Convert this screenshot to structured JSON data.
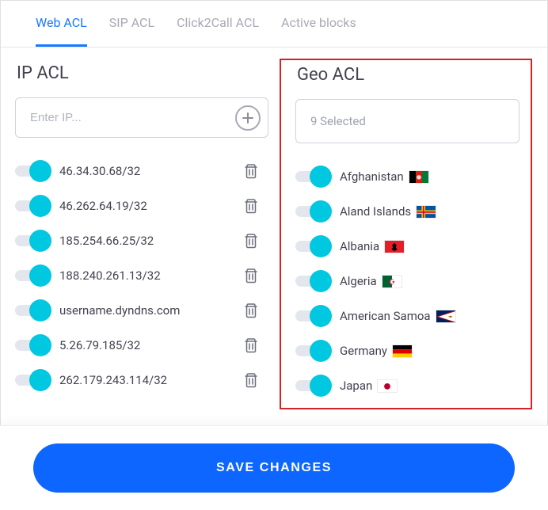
{
  "tabs": [
    {
      "label": "Web ACL",
      "active": true
    },
    {
      "label": "SIP ACL",
      "active": false
    },
    {
      "label": "Click2Call ACL",
      "active": false
    },
    {
      "label": "Active blocks",
      "active": false
    }
  ],
  "ip_acl": {
    "title": "IP ACL",
    "input_placeholder": "Enter IP...",
    "items": [
      "46.34.30.68/32",
      "46.262.64.19/32",
      "185.254.66.25/32",
      "188.240.261.13/32",
      "username.dyndns.com",
      "5.26.79.185/32",
      "262.179.243.114/32"
    ]
  },
  "geo_acl": {
    "title": "Geo ACL",
    "selected_label": "9 Selected",
    "items": [
      {
        "name": "Afghanistan",
        "flag": "AF"
      },
      {
        "name": "Aland Islands",
        "flag": "AX"
      },
      {
        "name": "Albania",
        "flag": "AL"
      },
      {
        "name": "Algeria",
        "flag": "DZ"
      },
      {
        "name": "American Samoa",
        "flag": "AS"
      },
      {
        "name": "Germany",
        "flag": "DE"
      },
      {
        "name": "Japan",
        "flag": "JP"
      }
    ]
  },
  "save_label": "SAVE CHANGES"
}
